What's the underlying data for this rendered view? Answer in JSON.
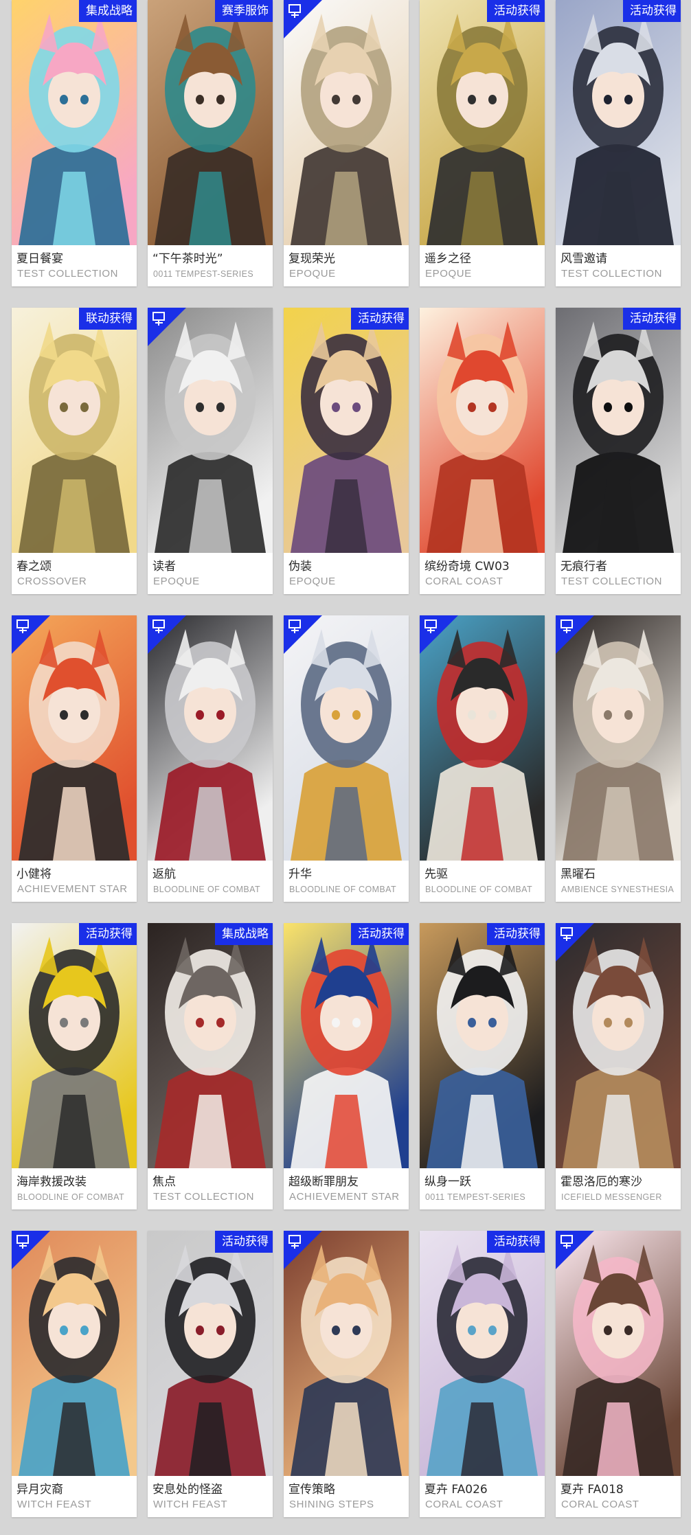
{
  "cards": [
    {
      "name": "夏日餐宴",
      "series": "TEST COLLECTION",
      "tag": "集成战略",
      "new": false,
      "palette": [
        "#f7a7c4",
        "#7fd8e8",
        "#ffd36b",
        "#2c6f97"
      ]
    },
    {
      "name": "“下午茶时光”",
      "series": "0011 TEMPEST-SERIES",
      "tag": "赛季服饰",
      "new": false,
      "palette": [
        "#8a5b34",
        "#2f8a8b",
        "#caa27a",
        "#3b2e26"
      ]
    },
    {
      "name": "复现荣光",
      "series": "EPOQUE",
      "tag": "",
      "new": true,
      "palette": [
        "#e7d1b1",
        "#b2a27f",
        "#fafafa",
        "#433a35"
      ]
    },
    {
      "name": "遥乡之径",
      "series": "EPOQUE",
      "tag": "活动获得",
      "new": false,
      "palette": [
        "#c8a84a",
        "#8b7b3b",
        "#eee2b0",
        "#303030"
      ]
    },
    {
      "name": "风雪邀请",
      "series": "TEST COLLECTION",
      "tag": "活动获得",
      "new": false,
      "palette": [
        "#d9dde6",
        "#2b2f3c",
        "#9aa6c8",
        "#1e2230"
      ]
    },
    {
      "name": "春之颂",
      "series": "CROSSOVER",
      "tag": "联动获得",
      "new": false,
      "palette": [
        "#f1d98a",
        "#cdb76a",
        "#f7f1dc",
        "#7a6a3c"
      ]
    },
    {
      "name": "读者",
      "series": "EPOQUE",
      "tag": "",
      "new": true,
      "palette": [
        "#f1f1f1",
        "#c6c6c6",
        "#8a8a8a",
        "#2e2e2e"
      ]
    },
    {
      "name": "伪装",
      "series": "EPOQUE",
      "tag": "活动获得",
      "new": false,
      "palette": [
        "#e8c89a",
        "#3a2f3f",
        "#f2d34b",
        "#6b4b7d"
      ]
    },
    {
      "name": "缤纷奇境 CW03",
      "series": "CORAL COAST",
      "tag": "",
      "new": false,
      "palette": [
        "#e0482f",
        "#f6c6a2",
        "#fdf1df",
        "#b33522"
      ]
    },
    {
      "name": "无痕行者",
      "series": "TEST COLLECTION",
      "tag": "活动获得",
      "new": false,
      "palette": [
        "#d7d7d7",
        "#1d1d1f",
        "#6d6d72",
        "#0f0f10"
      ]
    },
    {
      "name": "小健将",
      "series": "ACHIEVEMENT STAR",
      "tag": "",
      "new": true,
      "palette": [
        "#e0502e",
        "#f3d9c7",
        "#f4a85a",
        "#2d2d2d"
      ]
    },
    {
      "name": "返航",
      "series": "BLOODLINE OF COMBAT",
      "tag": "",
      "new": true,
      "palette": [
        "#efefef",
        "#c9c9cc",
        "#2a2a2e",
        "#9b1b28"
      ]
    },
    {
      "name": "升华",
      "series": "BLOODLINE OF COMBAT",
      "tag": "",
      "new": true,
      "palette": [
        "#d8dde6",
        "#5c6a84",
        "#f4f4f6",
        "#d9a23a"
      ]
    },
    {
      "name": "先驱",
      "series": "BLOODLINE OF COMBAT",
      "tag": "",
      "new": true,
      "palette": [
        "#2a2a2a",
        "#c22b2b",
        "#4aa3c8",
        "#e9e4d9"
      ]
    },
    {
      "name": "黑曜石",
      "series": "AMBIENCE SYNESTHESIA",
      "tag": "",
      "new": true,
      "palette": [
        "#ece7df",
        "#cfc3b4",
        "#2c2624",
        "#8b7a6a"
      ]
    },
    {
      "name": "海岸救援改装",
      "series": "BLOODLINE OF COMBAT",
      "tag": "活动获得",
      "new": false,
      "palette": [
        "#e7c71d",
        "#2b2b2b",
        "#f2f2f2",
        "#7a7a7a"
      ]
    },
    {
      "name": "焦点",
      "series": "TEST COLLECTION",
      "tag": "集成战略",
      "new": false,
      "palette": [
        "#6e6662",
        "#f2ede8",
        "#2b2321",
        "#a52a2a"
      ]
    },
    {
      "name": "超级断罪朋友",
      "series": "ACHIEVEMENT STAR",
      "tag": "活动获得",
      "new": false,
      "palette": [
        "#1f3f8f",
        "#e34531",
        "#fbe36a",
        "#f5f5f5"
      ]
    },
    {
      "name": "纵身一跃",
      "series": "0011 TEMPEST-SERIES",
      "tag": "活动获得",
      "new": false,
      "palette": [
        "#1c1c1e",
        "#f3f3f3",
        "#c89a5c",
        "#3a5f9a"
      ]
    },
    {
      "name": "霍恩洛厄的寒沙",
      "series": "ICEFIELD MESSENGER",
      "tag": "",
      "new": true,
      "palette": [
        "#7a4b3a",
        "#e8e8e8",
        "#2a2a2e",
        "#b28a5c"
      ]
    },
    {
      "name": "异月灾裔",
      "series": "WITCH FEAST",
      "tag": "",
      "new": true,
      "palette": [
        "#f3c88c",
        "#2a2a2e",
        "#e08a5a",
        "#4aa3c8"
      ]
    },
    {
      "name": "安息处的怪盗",
      "series": "WITCH FEAST",
      "tag": "活动获得",
      "new": false,
      "palette": [
        "#d8d8dc",
        "#1f1f22",
        "#c9c9c9",
        "#8a1d2a"
      ]
    },
    {
      "name": "宣传策略",
      "series": "SHINING STEPS",
      "tag": "",
      "new": true,
      "palette": [
        "#e9b27a",
        "#f3dec3",
        "#7b3e2f",
        "#2f3a56"
      ]
    },
    {
      "name": "夏卉 FA026",
      "series": "CORAL COAST",
      "tag": "活动获得",
      "new": false,
      "palette": [
        "#c9b6d8",
        "#2a2a36",
        "#e9e2ef",
        "#5aa3c8"
      ]
    },
    {
      "name": "夏卉 FA018",
      "series": "CORAL COAST",
      "tag": "",
      "new": true,
      "palette": [
        "#6a4636",
        "#f4b7c8",
        "#fbe7ee",
        "#3a2a26"
      ]
    }
  ],
  "colors": {
    "tag_bg": "#1a2fe8",
    "badge_bg": "#1a2fe8",
    "background": "#d6d6d6"
  },
  "icons": {
    "new_badge": "new-badge-icon"
  }
}
